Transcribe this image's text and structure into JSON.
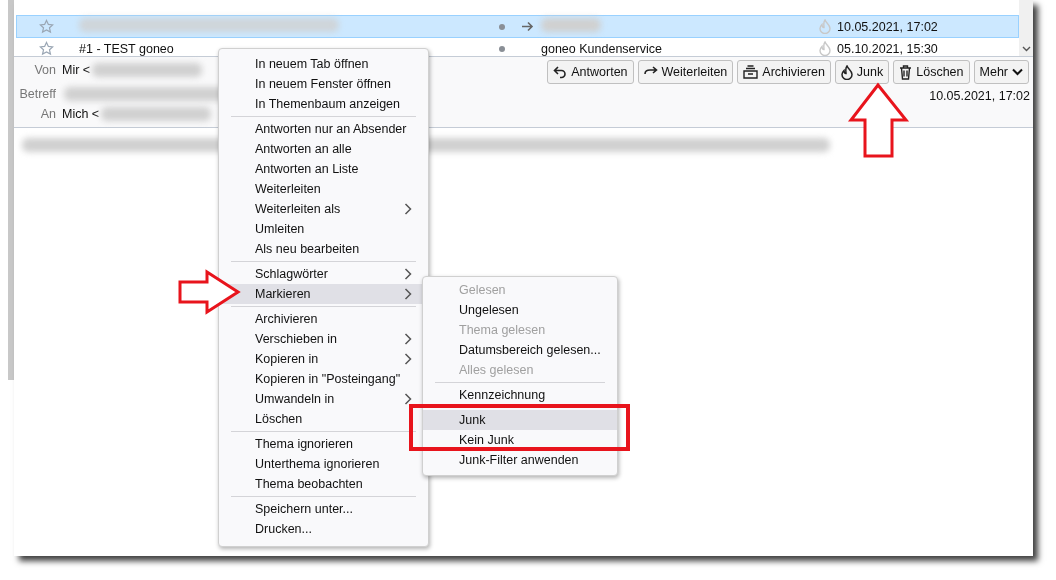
{
  "message_list": {
    "rows": [
      {
        "selected": true,
        "forwarded": true,
        "date": "10.05.2021, 17:02"
      },
      {
        "selected": false,
        "forwarded": false,
        "subject": "#1 - TEST goneo",
        "correspondent": "goneo Kundenservice",
        "date": "05.10.2021, 15:30"
      }
    ]
  },
  "message_header": {
    "fields": [
      {
        "label": "Von",
        "value": "Mir <"
      },
      {
        "label": "Betreff"
      },
      {
        "label": "An",
        "value": "Mich <"
      }
    ],
    "buttons": [
      {
        "label": "Antworten",
        "kind": "reply"
      },
      {
        "label": "Weiterleiten",
        "kind": "forward"
      },
      {
        "label": "Archivieren",
        "kind": "archive"
      },
      {
        "label": "Junk",
        "kind": "junk"
      },
      {
        "label": "Löschen",
        "kind": "delete"
      },
      {
        "label": "Mehr",
        "kind": "more"
      }
    ],
    "date": "10.05.2021, 17:02"
  },
  "context_menu": {
    "items": [
      {
        "kind": "item",
        "label": "In neuem Tab öffnen",
        "submenu": false,
        "highlighted": false
      },
      {
        "kind": "item",
        "label": "In neuem Fenster öffnen",
        "submenu": false,
        "highlighted": false
      },
      {
        "kind": "item",
        "label": "In Themenbaum anzeigen",
        "submenu": false,
        "highlighted": false
      },
      {
        "kind": "separator"
      },
      {
        "kind": "item",
        "label": "Antworten nur an Absender",
        "submenu": false,
        "highlighted": false
      },
      {
        "kind": "item",
        "label": "Antworten an alle",
        "submenu": false,
        "highlighted": false
      },
      {
        "kind": "item",
        "label": "Antworten an Liste",
        "submenu": false,
        "highlighted": false
      },
      {
        "kind": "item",
        "label": "Weiterleiten",
        "submenu": false,
        "highlighted": false
      },
      {
        "kind": "item",
        "label": "Weiterleiten als",
        "submenu": true,
        "highlighted": false
      },
      {
        "kind": "item",
        "label": "Umleiten",
        "submenu": false,
        "highlighted": false
      },
      {
        "kind": "item",
        "label": "Als neu bearbeiten",
        "submenu": false,
        "highlighted": false
      },
      {
        "kind": "separator"
      },
      {
        "kind": "item",
        "label": "Schlagwörter",
        "submenu": true,
        "highlighted": false
      },
      {
        "kind": "item",
        "label": "Markieren",
        "submenu": true,
        "highlighted": true
      },
      {
        "kind": "separator"
      },
      {
        "kind": "item",
        "label": "Archivieren",
        "submenu": false,
        "highlighted": false
      },
      {
        "kind": "item",
        "label": "Verschieben in",
        "submenu": true,
        "highlighted": false
      },
      {
        "kind": "item",
        "label": "Kopieren in",
        "submenu": true,
        "highlighted": false
      },
      {
        "kind": "item",
        "label": "Kopieren in \"Posteingang\"",
        "submenu": false,
        "highlighted": false
      },
      {
        "kind": "item",
        "label": "Umwandeln in",
        "submenu": true,
        "highlighted": false
      },
      {
        "kind": "item",
        "label": "Löschen",
        "submenu": false,
        "highlighted": false
      },
      {
        "kind": "separator"
      },
      {
        "kind": "item",
        "label": "Thema ignorieren",
        "submenu": false,
        "highlighted": false
      },
      {
        "kind": "item",
        "label": "Unterthema ignorieren",
        "submenu": false,
        "highlighted": false
      },
      {
        "kind": "item",
        "label": "Thema beobachten",
        "submenu": false,
        "highlighted": false
      },
      {
        "kind": "separator"
      },
      {
        "kind": "item",
        "label": "Speichern unter...",
        "submenu": false,
        "highlighted": false
      },
      {
        "kind": "item",
        "label": "Drucken...",
        "submenu": false,
        "highlighted": false
      }
    ]
  },
  "submenu": {
    "items": [
      {
        "kind": "item",
        "label": "Gelesen",
        "disabled": true,
        "highlighted": false
      },
      {
        "kind": "item",
        "label": "Ungelesen",
        "disabled": false,
        "highlighted": false
      },
      {
        "kind": "item",
        "label": "Thema gelesen",
        "disabled": true,
        "highlighted": false
      },
      {
        "kind": "item",
        "label": "Datumsbereich gelesen...",
        "disabled": false,
        "highlighted": false
      },
      {
        "kind": "item",
        "label": "Alles gelesen",
        "disabled": true,
        "highlighted": false
      },
      {
        "kind": "separator"
      },
      {
        "kind": "item",
        "label": "Kennzeichnung",
        "disabled": false,
        "highlighted": false
      },
      {
        "kind": "separator"
      },
      {
        "kind": "item",
        "label": "Junk",
        "disabled": false,
        "highlighted": true
      },
      {
        "kind": "item",
        "label": "Kein Junk",
        "disabled": false,
        "highlighted": false
      },
      {
        "kind": "item",
        "label": "Junk-Filter anwenden",
        "disabled": false,
        "highlighted": false
      }
    ]
  }
}
